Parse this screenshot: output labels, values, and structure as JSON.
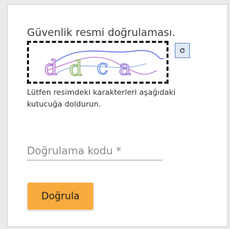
{
  "captcha": {
    "title": "Güvenlik resmi doğrulaması.",
    "image_text": "ddca",
    "hint": "Lütfen resimdeki karakterleri aşağıdaki kutucuğa doldurun.",
    "refresh_icon": "refresh-icon"
  },
  "form": {
    "code_placeholder": "Doğrulama kodu *",
    "code_value": "",
    "verify_label": "Doğrula"
  },
  "colors": {
    "button_bg": "#f9ab3e",
    "refresh_bg": "#dfe9f6",
    "refresh_border": "#6f94c9"
  }
}
